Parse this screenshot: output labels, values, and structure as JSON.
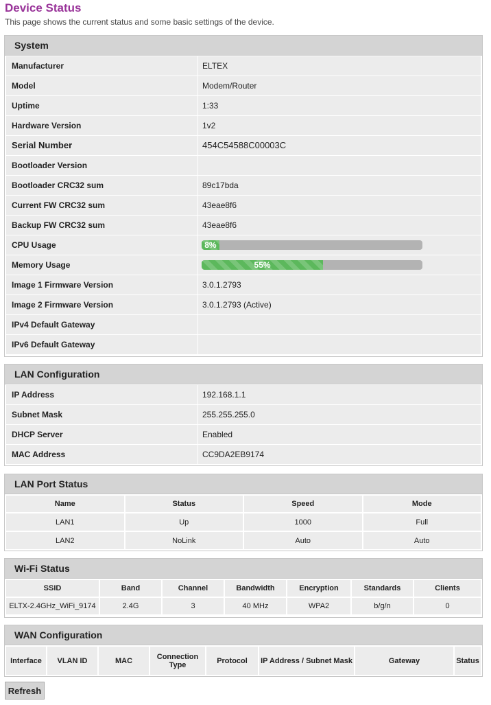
{
  "page": {
    "title": "Device Status",
    "subtitle": "This page shows the current status and some basic settings of the device."
  },
  "system": {
    "header": "System",
    "rows": [
      {
        "label": "Manufacturer",
        "value": "ELTEX"
      },
      {
        "label": "Model",
        "value": "Modem/Router"
      },
      {
        "label": "Uptime",
        "value": "1:33"
      },
      {
        "label": "Hardware Version",
        "value": "1v2"
      },
      {
        "label": "Serial Number",
        "value": "454C54588C00003C"
      },
      {
        "label": "Bootloader Version",
        "value": ""
      },
      {
        "label": "Bootloader CRC32 sum",
        "value": "89c17bda"
      },
      {
        "label": "Current FW CRC32 sum",
        "value": "43eae8f6"
      },
      {
        "label": "Backup FW CRC32 sum",
        "value": "43eae8f6"
      },
      {
        "label": "CPU Usage",
        "value": "8%",
        "percent": 8
      },
      {
        "label": "Memory Usage",
        "value": "55%",
        "percent": 55
      },
      {
        "label": "Image 1 Firmware Version",
        "value": "3.0.1.2793"
      },
      {
        "label": "Image 2 Firmware Version",
        "value": "3.0.1.2793 (Active)"
      },
      {
        "label": "IPv4 Default Gateway",
        "value": ""
      },
      {
        "label": "IPv6 Default Gateway",
        "value": ""
      }
    ]
  },
  "lan_config": {
    "header": "LAN Configuration",
    "rows": [
      {
        "label": "IP Address",
        "value": "192.168.1.1"
      },
      {
        "label": "Subnet Mask",
        "value": "255.255.255.0"
      },
      {
        "label": "DHCP Server",
        "value": "Enabled"
      },
      {
        "label": "MAC Address",
        "value": "CC9DA2EB9174"
      }
    ]
  },
  "lan_ports": {
    "header": "LAN Port Status",
    "columns": [
      "Name",
      "Status",
      "Speed",
      "Mode"
    ],
    "rows": [
      [
        "LAN1",
        "Up",
        "1000",
        "Full"
      ],
      [
        "LAN2",
        "NoLink",
        "Auto",
        "Auto"
      ]
    ]
  },
  "wifi": {
    "header": "Wi-Fi Status",
    "columns": [
      "SSID",
      "Band",
      "Channel",
      "Bandwidth",
      "Encryption",
      "Standards",
      "Clients"
    ],
    "rows": [
      [
        "ELTX-2.4GHz_WiFi_9174",
        "2.4G",
        "3",
        "40 MHz",
        "WPA2",
        "b/g/n",
        "0"
      ]
    ]
  },
  "wan": {
    "header": "WAN Configuration",
    "columns": [
      "Interface",
      "VLAN ID",
      "MAC",
      "Connection Type",
      "Protocol",
      "IP Address / Subnet Mask",
      "Gateway",
      "Status"
    ]
  },
  "actions": {
    "refresh_label": "Refresh"
  },
  "colors": {
    "title": "#993399",
    "header_bg": "#d4d4d4",
    "cell_bg": "#ececec",
    "bar_fill": "#5cb85c",
    "bar_track": "#b3b3b3"
  }
}
